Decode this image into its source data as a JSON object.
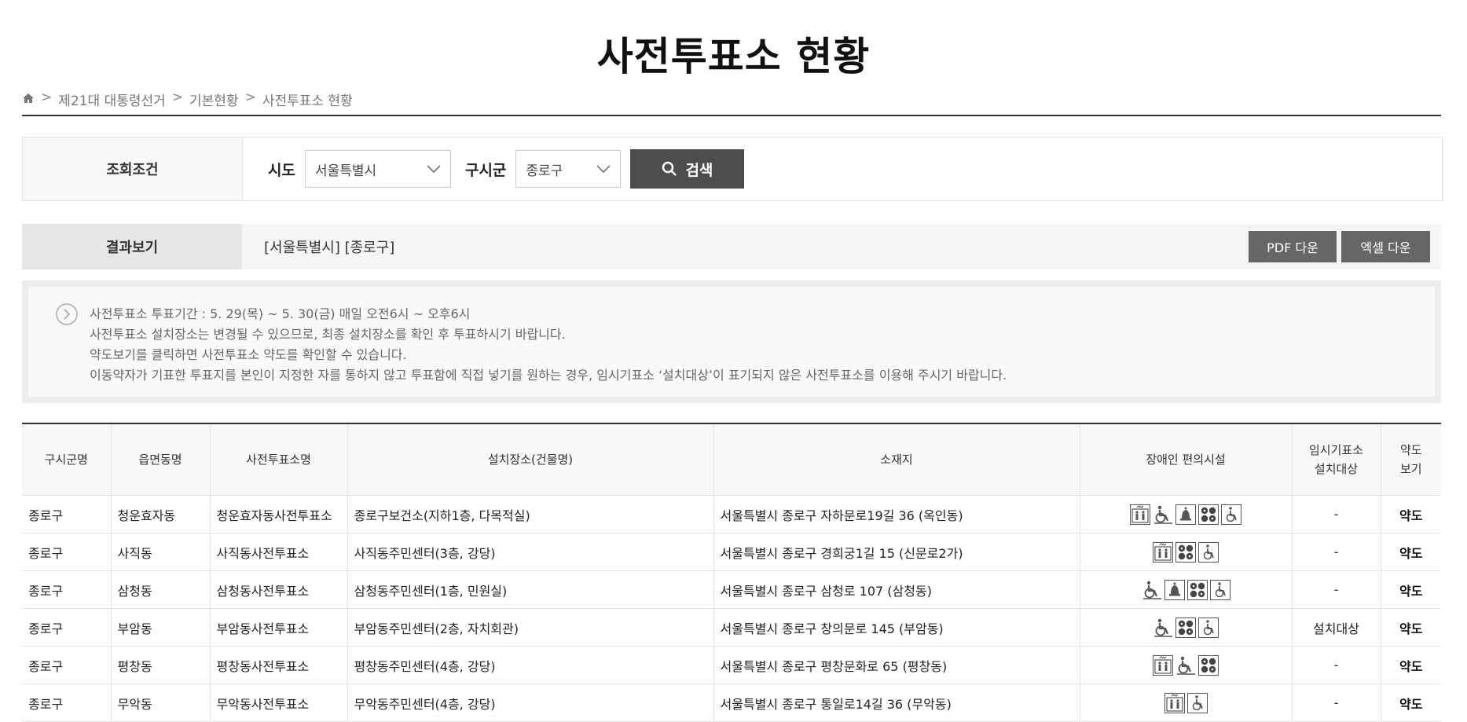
{
  "page": {
    "title": "사전투표소 현황"
  },
  "breadcrumb": {
    "items": [
      "제21대 대통령선거",
      "기본현황",
      "사전투표소 현황"
    ],
    "sep": ">"
  },
  "search": {
    "label": "조회조건",
    "sido_label": "시도",
    "sido_value": "서울특별시",
    "gugun_label": "구시군",
    "gugun_value": "종로구",
    "button_label": "검색"
  },
  "result": {
    "label": "결과보기",
    "text": "[서울특별시] [종로구]",
    "pdf_label": "PDF 다운",
    "excel_label": "엑셀 다운"
  },
  "notice": {
    "lines": [
      "사전투표소 투표기간 : 5. 29(목) ~ 5. 30(금) 매일 오전6시 ~ 오후6시",
      "사전투표소 설치장소는 변경될 수 있으므로, 최종 설치장소를 확인 후 투표하시기 바랍니다.",
      "약도보기를 클릭하면 사전투표소 약도를 확인할 수 있습니다.",
      "이동약자가 기표한 투표지를 본인이 지정한 자를 통하지 않고 투표함에 직접 넣기를 원하는 경우, 임시기표소 ‘설치대상’이 표기되지 않은 사전투표소를 이용해 주시기 바랍니다."
    ]
  },
  "table": {
    "headers": {
      "gugun": "구시군명",
      "dong": "읍면동명",
      "station": "사전투표소명",
      "place": "설치장소(건물명)",
      "address": "소재지",
      "facility": "장애인 편의시설",
      "temp1": "임시기표소",
      "temp2": "설치대상",
      "map1": "약도",
      "map2": "보기"
    },
    "rows": [
      {
        "gugun": "종로구",
        "dong": "청운효자동",
        "station": "청운효자동사전투표소",
        "place": "종로구보건소(지하1층, 다목적실)",
        "address": "서울특별시 종로구 자하문로19길 36 (옥인동)",
        "facilities": [
          "elevator-icon",
          "ramp-icon",
          "bell-icon",
          "braille-icon",
          "wheelchair-icon"
        ],
        "temp": "-",
        "map": "약도"
      },
      {
        "gugun": "종로구",
        "dong": "사직동",
        "station": "사직동사전투표소",
        "place": "사직동주민센터(3층, 강당)",
        "address": "서울특별시 종로구 경희궁1길 15 (신문로2가)",
        "facilities": [
          "elevator-icon",
          "braille-icon",
          "wheelchair-icon"
        ],
        "temp": "-",
        "map": "약도"
      },
      {
        "gugun": "종로구",
        "dong": "삼청동",
        "station": "삼청동사전투표소",
        "place": "삼청동주민센터(1층, 민원실)",
        "address": "서울특별시 종로구 삼청로 107 (삼청동)",
        "facilities": [
          "ramp-icon",
          "bell-icon",
          "braille-icon",
          "wheelchair-icon"
        ],
        "temp": "-",
        "map": "약도"
      },
      {
        "gugun": "종로구",
        "dong": "부암동",
        "station": "부암동사전투표소",
        "place": "부암동주민센터(2층, 자치회관)",
        "address": "서울특별시 종로구 창의문로 145 (부암동)",
        "facilities": [
          "ramp-icon",
          "braille-icon",
          "wheelchair-icon"
        ],
        "temp": "설치대상",
        "map": "약도"
      },
      {
        "gugun": "종로구",
        "dong": "평창동",
        "station": "평창동사전투표소",
        "place": "평창동주민센터(4층, 강당)",
        "address": "서울특별시 종로구 평창문화로 65 (평창동)",
        "facilities": [
          "elevator-icon",
          "ramp-icon",
          "braille-icon"
        ],
        "temp": "-",
        "map": "약도"
      },
      {
        "gugun": "종로구",
        "dong": "무악동",
        "station": "무악동사전투표소",
        "place": "무악동주민센터(4층, 강당)",
        "address": "서울특별시 종로구 통일로14길 36 (무악동)",
        "facilities": [
          "elevator-icon",
          "wheelchair-icon"
        ],
        "temp": "-",
        "map": "약도"
      }
    ]
  }
}
